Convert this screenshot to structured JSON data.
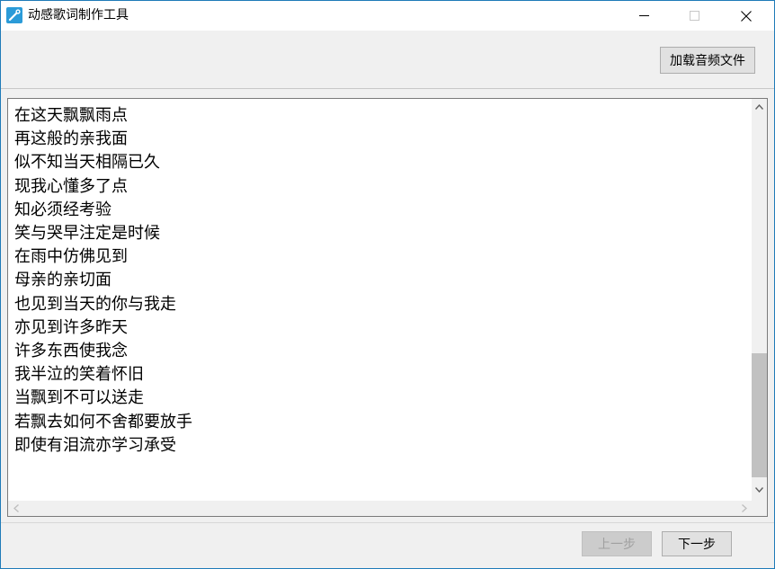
{
  "window": {
    "title": "动感歌词制作工具"
  },
  "toolbar": {
    "load_audio_label": "加载音频文件"
  },
  "lyrics": {
    "lines": [
      "在这天飘飘雨点",
      "再这般的亲我面",
      "似不知当天相隔已久",
      "现我心懂多了点",
      "知必须经考验",
      "笑与哭早注定是时候",
      "在雨中仿佛见到",
      "母亲的亲切面",
      "也见到当天的你与我走",
      "亦见到许多昨天",
      "许多东西使我念",
      "我半泣的笑着怀旧",
      "当飘到不可以送走",
      "若飘去如何不舍都要放手",
      "即使有泪流亦学习承受"
    ]
  },
  "footer": {
    "prev_label": "上一步",
    "next_label": "下一步",
    "prev_enabled": false
  },
  "colors": {
    "window_border": "#1f7bb8",
    "icon_bg": "#2b9bd8",
    "disabled_text": "#a0a0a0"
  },
  "icons": [
    "app-icon",
    "minimize-icon",
    "maximize-icon",
    "close-icon",
    "scroll-up-icon",
    "scroll-down-icon",
    "scroll-left-icon",
    "scroll-right-icon"
  ]
}
